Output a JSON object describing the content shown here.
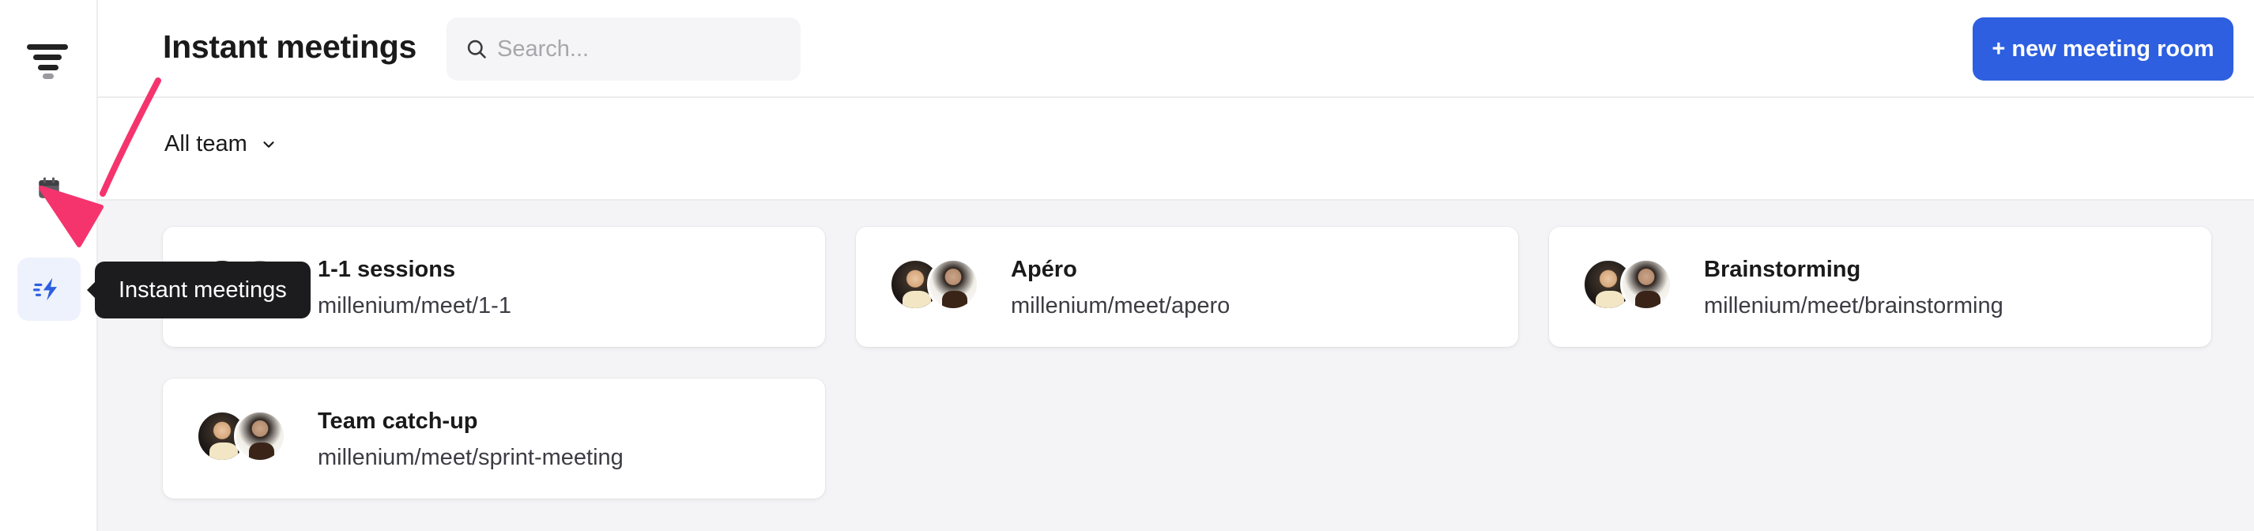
{
  "page": {
    "title": "Instant meetings"
  },
  "search": {
    "placeholder": "Search..."
  },
  "actions": {
    "new_room_label": "+ new meeting room"
  },
  "filter": {
    "selected": "All team"
  },
  "sidebar": {
    "items": [
      {
        "name": "calendar",
        "icon": "calendar-icon"
      },
      {
        "name": "instant-meetings",
        "icon": "bolt-icon",
        "active": true
      }
    ],
    "tooltip": "Instant meetings"
  },
  "colors": {
    "accent": "#2d5fe0",
    "active_bg": "#edf2fd",
    "tooltip_bg": "#1c1c1e",
    "annotation_arrow": "#f5346e",
    "content_bg": "#f4f4f6"
  },
  "rooms": [
    {
      "title": "1-1 sessions",
      "url": "millenium/meet/1-1"
    },
    {
      "title": "Apéro",
      "url": "millenium/meet/apero"
    },
    {
      "title": "Brainstorming",
      "url": "millenium/meet/brainstorming"
    },
    {
      "title": "Team catch-up",
      "url": "millenium/meet/sprint-meeting"
    }
  ]
}
